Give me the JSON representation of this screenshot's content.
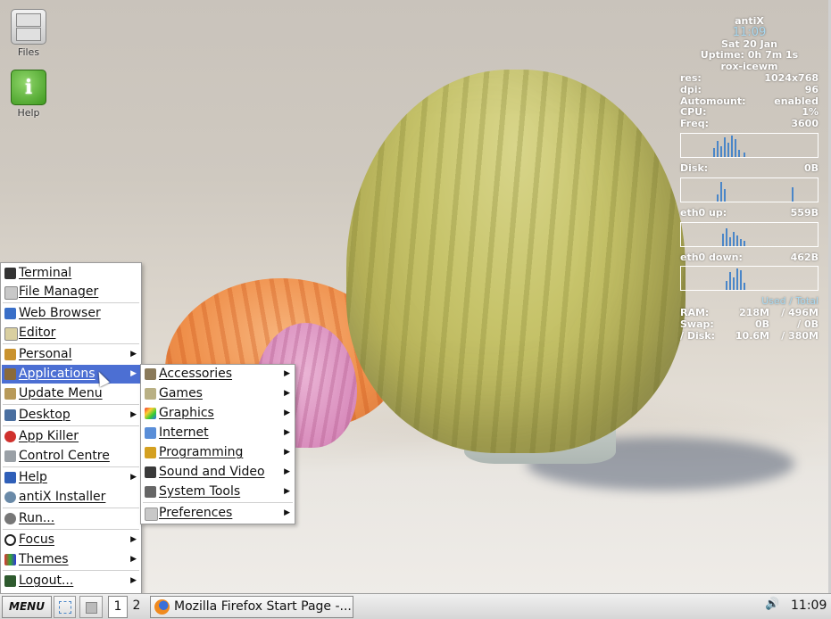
{
  "desktop": {
    "icons": [
      {
        "label": "Files",
        "icon": "file-cabinet-icon"
      },
      {
        "label": "Help",
        "icon": "help-info-icon"
      }
    ]
  },
  "conky": {
    "title": "antiX",
    "time": "11:09",
    "date": "Sat 20 Jan",
    "uptime": "Uptime: 0h 7m 1s",
    "wm": "rox-icewm",
    "stats": [
      {
        "k": "res:",
        "v": "1024x768"
      },
      {
        "k": "dpi:",
        "v": "96"
      },
      {
        "k": "Automount:",
        "v": "enabled"
      },
      {
        "k": "CPU:",
        "v": "1%"
      },
      {
        "k": "Freq:",
        "v": "3600"
      }
    ],
    "disk": {
      "k": "Disk:",
      "v": "0B"
    },
    "eth_up": {
      "k": "eth0 up:",
      "v": "559B"
    },
    "eth_down": {
      "k": "eth0 down:",
      "v": "462B"
    },
    "usage_title": "Used / Total",
    "mem": [
      {
        "k": "RAM:",
        "v1": "218M",
        "v2": "/ 496M"
      },
      {
        "k": "Swap:",
        "v1": "0B",
        "v2": "/ 0B"
      },
      {
        "k": "/ Disk:",
        "v1": "10.6M",
        "v2": "/ 380M"
      }
    ]
  },
  "main_menu": {
    "items": [
      {
        "label": "Terminal",
        "icon": "terminal-icon",
        "submenu": false
      },
      {
        "label": "File Manager",
        "icon": "file-manager-icon",
        "submenu": false
      },
      {
        "label": "Web Browser",
        "icon": "web-browser-icon",
        "submenu": false
      },
      {
        "label": "Editor",
        "icon": "editor-icon",
        "submenu": false
      },
      {
        "label": "Personal",
        "icon": "personal-icon",
        "submenu": true
      },
      {
        "label": "Applications",
        "icon": "applications-icon",
        "submenu": true,
        "highlighted": true
      },
      {
        "label": "Update Menu",
        "icon": "update-menu-icon",
        "submenu": false
      },
      {
        "label": "Desktop",
        "icon": "desktop-icon",
        "submenu": true
      },
      {
        "label": "App Killer",
        "icon": "app-killer-icon",
        "submenu": false
      },
      {
        "label": "Control Centre",
        "icon": "control-centre-icon",
        "submenu": false
      },
      {
        "label": "Help",
        "icon": "help-icon",
        "submenu": true
      },
      {
        "label": "antiX Installer",
        "icon": "installer-icon",
        "submenu": false
      },
      {
        "label": "Run...",
        "icon": "run-gear-icon",
        "submenu": false
      },
      {
        "label": "Focus",
        "icon": "focus-icon",
        "submenu": true
      },
      {
        "label": "Themes",
        "icon": "themes-icon",
        "submenu": true
      },
      {
        "label": "Logout...",
        "icon": "logout-icon",
        "submenu": true
      }
    ]
  },
  "sub_menu": {
    "items": [
      {
        "label": "Accessories",
        "icon": "accessories-icon"
      },
      {
        "label": "Games",
        "icon": "games-icon"
      },
      {
        "label": "Graphics",
        "icon": "graphics-icon"
      },
      {
        "label": "Internet",
        "icon": "internet-icon"
      },
      {
        "label": "Programming",
        "icon": "programming-icon"
      },
      {
        "label": "Sound and Video",
        "icon": "sound-video-icon"
      },
      {
        "label": "System Tools",
        "icon": "system-tools-icon"
      },
      {
        "label": "Preferences",
        "icon": "preferences-icon"
      }
    ]
  },
  "taskbar": {
    "menu_label": "MENU",
    "workspaces": [
      "1",
      "2"
    ],
    "active_workspace": "1",
    "task_title": "Mozilla Firefox Start Page -...",
    "clock": "11:09"
  },
  "colors": {
    "menu_highlight": "#4c6fd3",
    "conky_accent": "#a8d8f0",
    "graph_fill": "#4a86c8"
  }
}
